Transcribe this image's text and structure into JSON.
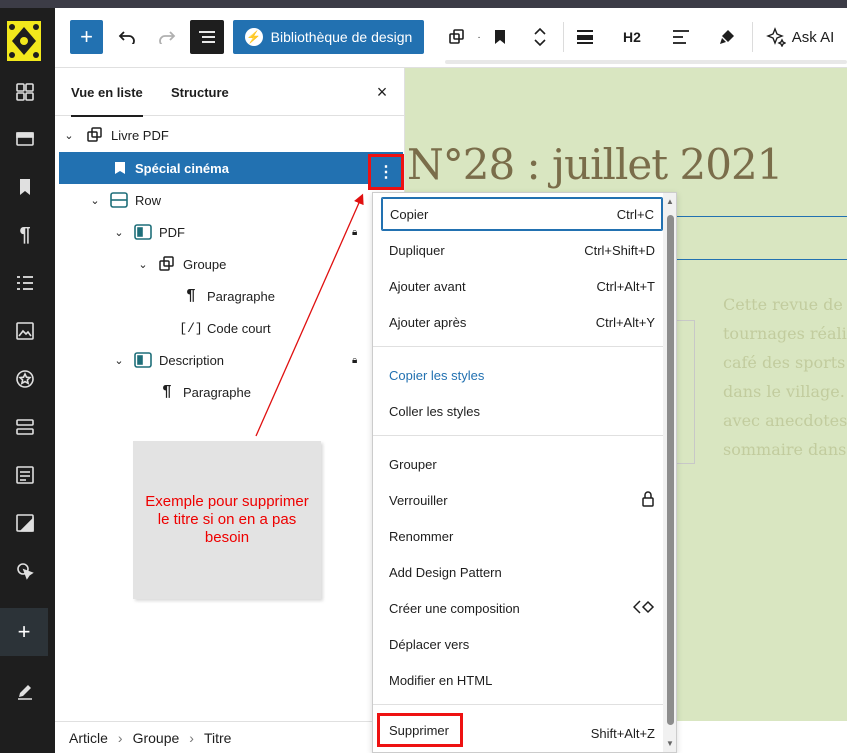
{
  "toolbar": {
    "library_label": "Bibliothèque de design",
    "heading_level": "H2",
    "ask_ai_label": "Ask AI"
  },
  "list_panel": {
    "tab_list": "Vue en liste",
    "tab_structure": "Structure",
    "close_symbol": "×",
    "items": [
      {
        "label": "Livre PDF",
        "icon": "group-icon",
        "expanded": true,
        "locked": false
      },
      {
        "label": "Spécial cinéma",
        "icon": "bookmark-icon",
        "selected": true,
        "locked": false
      },
      {
        "label": "Row",
        "icon": "row-icon",
        "expanded": true,
        "locked": false
      },
      {
        "label": "PDF",
        "icon": "column-icon",
        "expanded": true,
        "locked": true
      },
      {
        "label": "Groupe",
        "icon": "group-icon",
        "expanded": true,
        "locked": false
      },
      {
        "label": "Paragraphe",
        "icon": "paragraph-icon",
        "locked": false
      },
      {
        "label": "Code court",
        "icon": "shortcode-icon",
        "locked": false
      },
      {
        "label": "Description",
        "icon": "column-icon",
        "expanded": true,
        "locked": true
      },
      {
        "label": "Paragraphe",
        "icon": "paragraph-icon",
        "locked": false
      }
    ]
  },
  "annotation": {
    "note": "Exemple pour supprimer le titre si on en a pas besoin",
    "color": "#e01010"
  },
  "breadcrumb": [
    "Article",
    "Groupe",
    "Titre"
  ],
  "canvas": {
    "title": "N°28 : juillet 2021",
    "text_lines": [
      "Cette revue de",
      "tournages réali",
      "café des sports",
      "dans le village.",
      "avec anecdotes",
      "sommaire dans"
    ],
    "background": "#d9e6c1"
  },
  "menu": {
    "groups": [
      [
        {
          "label": "Copier",
          "shortcut": "Ctrl+C",
          "focused": true
        },
        {
          "label": "Dupliquer",
          "shortcut": "Ctrl+Shift+D"
        },
        {
          "label": "Ajouter avant",
          "shortcut": "Ctrl+Alt+T"
        },
        {
          "label": "Ajouter après",
          "shortcut": "Ctrl+Alt+Y"
        }
      ],
      [
        {
          "label": "Copier les styles",
          "accent": true
        },
        {
          "label": "Coller les styles"
        }
      ],
      [
        {
          "label": "Grouper"
        },
        {
          "label": "Verrouiller",
          "icon": "lock-icon"
        },
        {
          "label": "Renommer"
        },
        {
          "label": "Add Design Pattern"
        },
        {
          "label": "Créer une composition",
          "icon": "pattern-icon"
        },
        {
          "label": "Déplacer vers"
        },
        {
          "label": "Modifier en HTML"
        }
      ],
      [
        {
          "label": "Supprimer",
          "shortcut": "Shift+Alt+Z",
          "highlighted": true
        }
      ]
    ]
  },
  "colors": {
    "accent": "#2271b1",
    "sidebar": "#1e1e1e",
    "highlight_red": "#e11111"
  }
}
